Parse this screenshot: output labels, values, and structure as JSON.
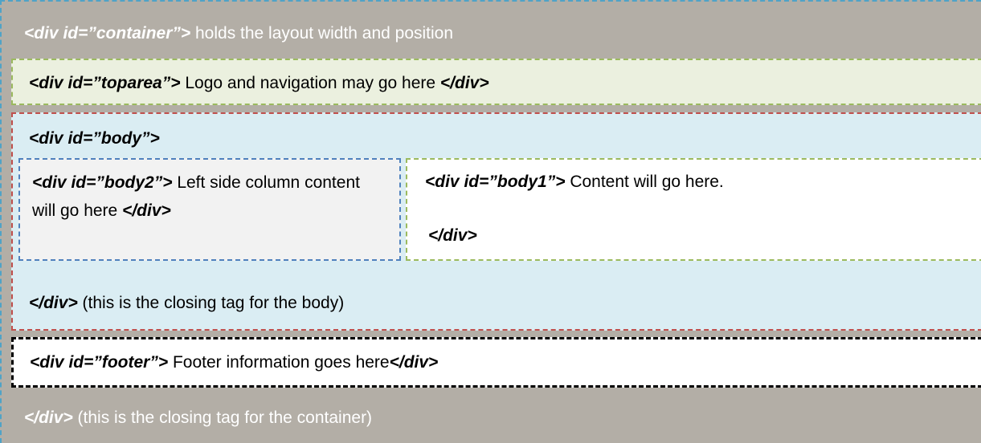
{
  "container": {
    "open_tag": "<div id=”container”>",
    "open_text": " holds the layout width and position",
    "close_tag": "</div>",
    "close_text": " (this is the closing tag for the container)"
  },
  "toparea": {
    "open_tag": "<div id=”toparea”>",
    "text": " Logo and navigation may go here ",
    "close_tag": "</div>"
  },
  "body": {
    "open_tag": "<div id=”body”>",
    "close_tag": "</div>",
    "close_text": " (this is the closing tag for the body)"
  },
  "body2": {
    "open_tag": "<div id=”body2”>",
    "text": " Left side column content will go here ",
    "close_tag": "</div>"
  },
  "body1": {
    "open_tag": "<div id=”body1”>",
    "text": " Content will go here.",
    "close_tag": "</div>"
  },
  "footer": {
    "open_tag": "<div id=”footer”>",
    "text": " Footer information goes here",
    "close_tag": "</div>"
  },
  "colors": {
    "container_bg": "#b3aea6",
    "container_border": "#4fa3c7",
    "toparea_bg": "#ebf0df",
    "toparea_border": "#9bba5e",
    "body_bg": "#daedf3",
    "body_border": "#c0504d",
    "body2_bg": "#f2f2f2",
    "body2_border": "#4f81bd",
    "body1_bg": "#ffffff",
    "body1_border": "#9bba5e",
    "footer_bg": "#ffffff",
    "footer_border": "#000000"
  }
}
